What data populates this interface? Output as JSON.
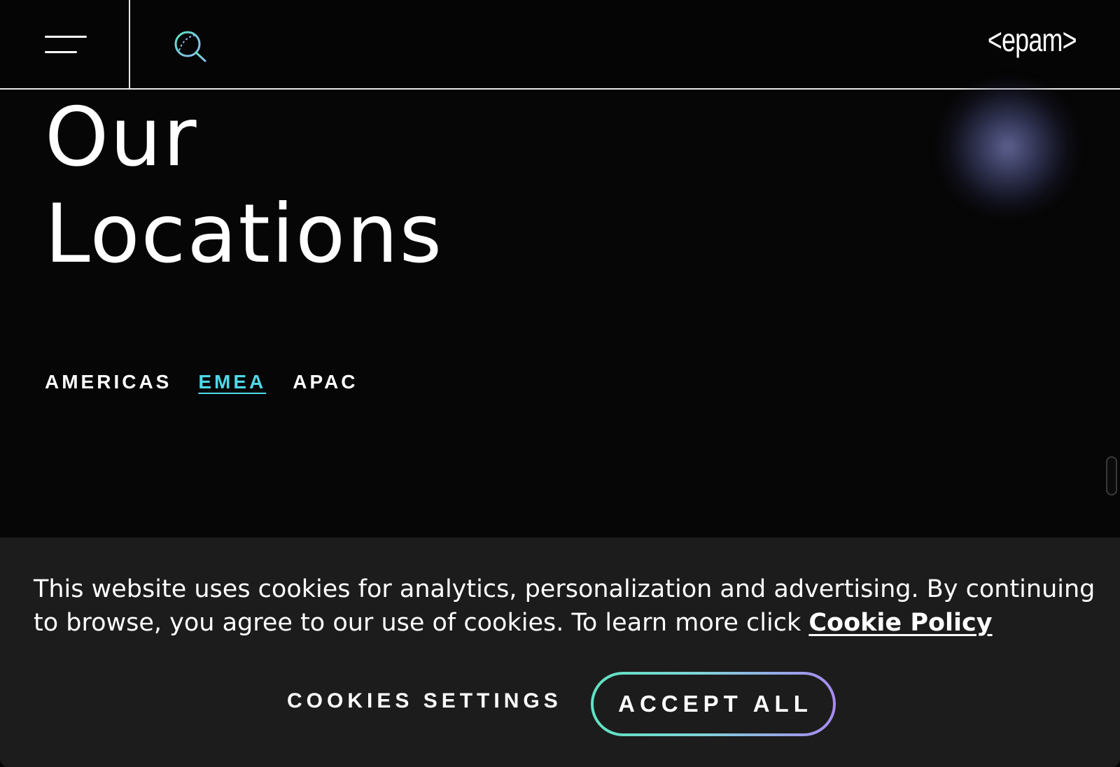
{
  "header": {
    "menu_icon": "hamburger-menu-icon",
    "search_icon": "search-icon",
    "logo_text": "<epam>"
  },
  "main": {
    "title_line1": "Our",
    "title_line2": "Locations",
    "tabs": [
      {
        "label": "AMERICAS",
        "active": false
      },
      {
        "label": "EMEA",
        "active": true
      },
      {
        "label": "APAC",
        "active": false
      }
    ]
  },
  "cookie_banner": {
    "text": "This website uses cookies for analytics, personalization and advertising. By continuing to browse, you agree to our use of cookies. To learn more click ",
    "policy_link": "Cookie Policy",
    "settings_label": "COOKIES SETTINGS",
    "accept_label": "ACCEPT ALL"
  },
  "colors": {
    "background": "#060606",
    "accent": "#4fd8e8",
    "banner": "#1c1c1c",
    "gradient_start": "#5fe3c0",
    "gradient_end": "#a78bf0"
  }
}
